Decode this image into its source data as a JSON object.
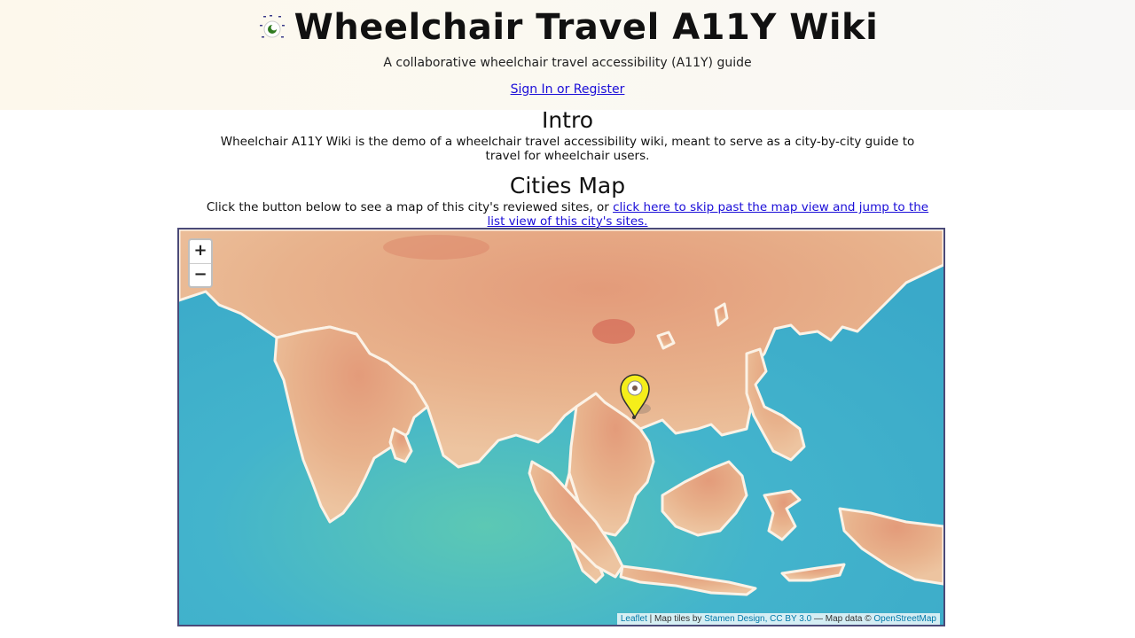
{
  "header": {
    "title": "Wheelchair Travel A11Y Wiki",
    "tagline": "A collaborative wheelchair travel accessibility (A11Y) guide",
    "signin_label": "Sign In or Register"
  },
  "intro": {
    "heading": "Intro",
    "text": "Wheelchair A11Y Wiki is the demo of a wheelchair travel accessibility wiki, meant to serve as a city-by-city guide to travel for wheelchair users."
  },
  "cities_map": {
    "heading": "Cities Map",
    "text_before_link": "Click the button below to see a map of this city's reviewed sites, or ",
    "link_text": "click here to skip past the map view and jump to the list view of this city's sites."
  },
  "map": {
    "zoom_in": "+",
    "zoom_out": "−",
    "attribution": {
      "leaflet": "Leaflet",
      "tiles_prefix": " | Map tiles by ",
      "stamen": "Stamen Design, CC BY 3.0",
      "data_prefix": " — Map data © ",
      "osm": "OpenStreetMap"
    },
    "marker_color": "#f5ee1a",
    "ocean_color": "#45b8c8",
    "land_color": "#e7b08a"
  }
}
